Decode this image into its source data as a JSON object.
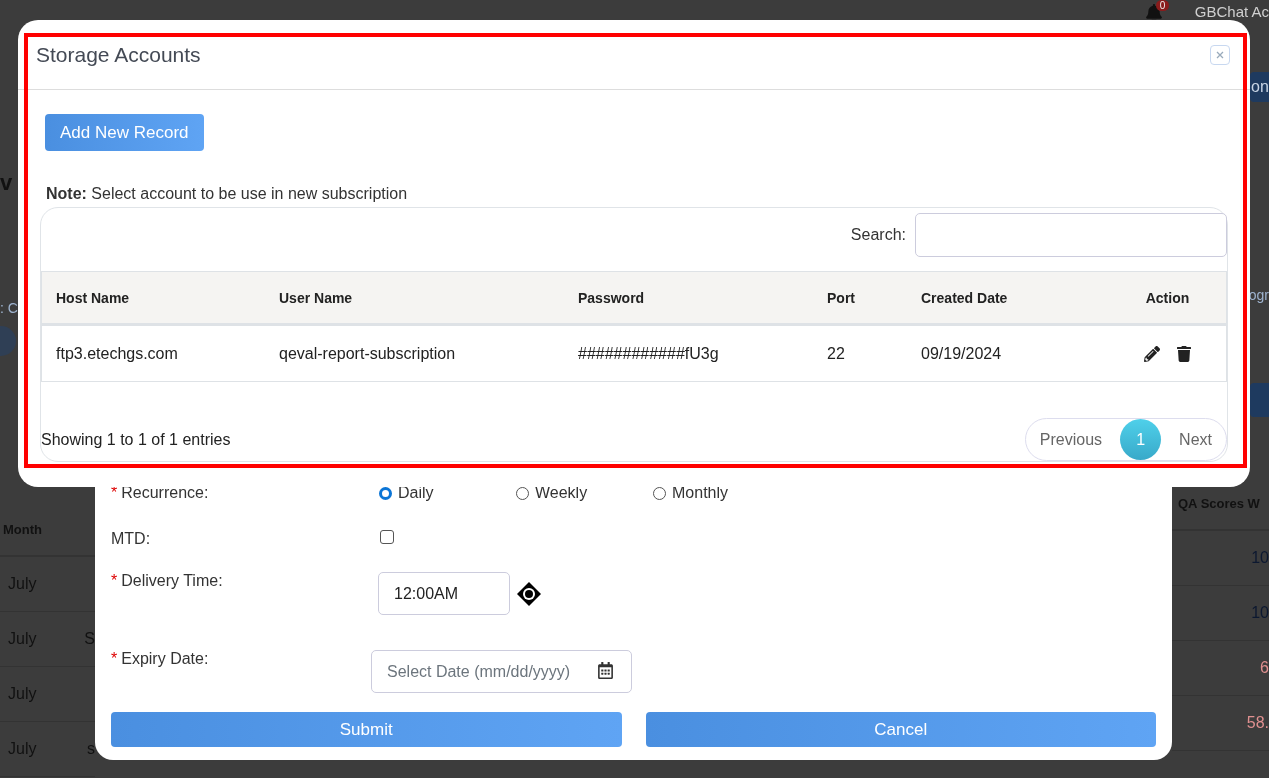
{
  "background": {
    "notification_count": "0",
    "user_name": "GBChat Ac",
    "heading": "v",
    "left_label": ": C",
    "right_button": "on",
    "right_label": "ogr",
    "table": {
      "columns": [
        "Month",
        "QA Scores W"
      ],
      "rows": [
        {
          "month": "July",
          "score": "10",
          "flagged": false
        },
        {
          "month": "July",
          "column_2": "S",
          "score": "10",
          "flagged": false
        },
        {
          "month": "July",
          "score": "6",
          "flagged": true
        },
        {
          "month": "July",
          "column_2": "s",
          "score": "58.",
          "flagged": true
        }
      ]
    }
  },
  "subscription_form": {
    "recurrence": {
      "label": "Recurrence:",
      "required_mark": "*",
      "options": [
        {
          "label": "Daily",
          "selected": true
        },
        {
          "label": "Weekly",
          "selected": false
        },
        {
          "label": "Monthly",
          "selected": false
        }
      ]
    },
    "mtd": {
      "label": "MTD:",
      "checked": false
    },
    "delivery_time": {
      "label": "Delivery Time:",
      "required_mark": "*",
      "value": "12:00AM"
    },
    "expiry_date": {
      "label": "Expiry Date:",
      "required_mark": "*",
      "placeholder": "Select Date (mm/dd/yyyy)"
    },
    "buttons": [
      "Submit",
      "Cancel"
    ]
  },
  "storage_modal": {
    "title": "Storage Accounts",
    "add_button": "Add New Record",
    "note_label": "Note:",
    "note": "Select account to be use in new subscription",
    "search_label": "Search:",
    "table": {
      "columns": [
        "Host Name",
        "User Name",
        "Password",
        "Port",
        "Created Date",
        "Action"
      ],
      "rows": [
        {
          "host": "ftp3.etechgs.com",
          "user": "qeval-report-subscription",
          "password": "############fU3g",
          "port": "22",
          "created": "09/19/2024"
        }
      ]
    },
    "info": "Showing 1 to 1 of 1 entries",
    "pagination": [
      {
        "label": "Previous",
        "selected": false
      },
      {
        "label": "1",
        "selected": true
      },
      {
        "label": "Next",
        "selected": false
      }
    ]
  }
}
